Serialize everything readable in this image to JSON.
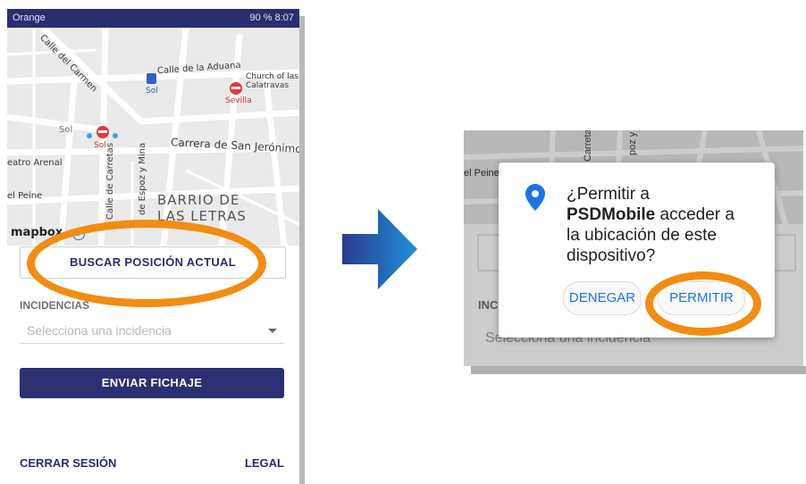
{
  "left_phone": {
    "status_bar": {
      "carrier": "Orange",
      "right": "90 % 8:07"
    },
    "map_labels": [
      "Calle del Carmen",
      "Calle de la Aduana",
      "Church of las Calatravas",
      "Sol",
      "Sevilla",
      "Sol",
      "Sol",
      "Carrera de San Jerónimo",
      "eatro Arenal",
      "Calle de Carretas",
      "de Espoz y Mina",
      "el Peine",
      "BARRIO DE",
      "LAS LETRAS"
    ],
    "map_attribution": "mapbox",
    "buscar_button": "BUSCAR POSICIÓN ACTUAL",
    "incidencias_label": "INCIDENCIAS",
    "incidencia_select_placeholder": "Selecciona una incidencia",
    "enviar_button": "ENVIAR FICHAJE",
    "cerrar_sesion": "CERRAR SESIÓN",
    "legal": "LEGAL"
  },
  "right_phone": {
    "background_fragments": {
      "left_text": "el Peine",
      "section": "INC",
      "select": "Selecciona una incidencia",
      "street1": "Carreta",
      "street2": "poz y M"
    },
    "dialog": {
      "line1": "¿Permitir a",
      "app_name": "PSDMobile",
      "line2": " acceder a",
      "line3": "la ubicación de este",
      "line4": "dispositivo?",
      "deny_button": "DENEGAR",
      "allow_button": "PERMITIR"
    }
  },
  "colors": {
    "navy": "#2c2f72",
    "orange_highlight": "#f28c12",
    "dialog_accent": "#1a73e8",
    "arrow": "#1f6fc0"
  },
  "icons": [
    "location-pin-icon",
    "arrow-right-icon",
    "metro-icon",
    "info-icon"
  ]
}
